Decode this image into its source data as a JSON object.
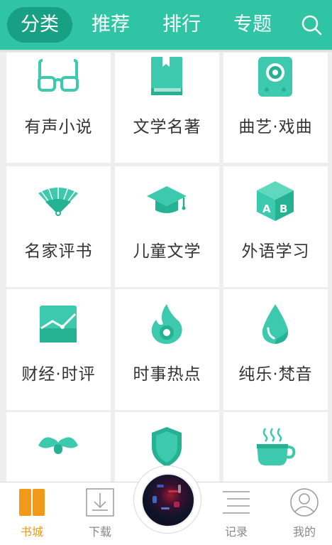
{
  "header": {
    "tabs": [
      {
        "label": "分类",
        "active": true
      },
      {
        "label": "推荐",
        "active": false
      },
      {
        "label": "排行",
        "active": false
      },
      {
        "label": "专题",
        "active": false
      }
    ],
    "search_icon": "search-icon"
  },
  "colors": {
    "brand": "#2fc4a4",
    "brand_dark": "#17a083",
    "icon": "#3cc9ae",
    "icon_dark": "#25b293",
    "active_nav": "#f19a1a"
  },
  "categories": [
    {
      "label": "有声小说",
      "icon": "glasses-icon"
    },
    {
      "label": "文学名著",
      "icon": "book-icon"
    },
    {
      "label": "曲艺·戏曲",
      "icon": "speaker-icon"
    },
    {
      "label": "名家评书",
      "icon": "fan-icon"
    },
    {
      "label": "儿童文学",
      "icon": "graduation-cap-icon"
    },
    {
      "label": "外语学习",
      "icon": "letter-cube-icon"
    },
    {
      "label": "财经·时评",
      "icon": "chart-icon"
    },
    {
      "label": "时事热点",
      "icon": "flame-icon"
    },
    {
      "label": "纯乐·梵音",
      "icon": "water-drop-icon"
    },
    {
      "label": "",
      "icon": "mustache-icon"
    },
    {
      "label": "",
      "icon": "shield-icon"
    },
    {
      "label": "",
      "icon": "coffee-cup-icon"
    }
  ],
  "bottom_nav": [
    {
      "label": "书城",
      "icon": "bookstore-icon",
      "active": true
    },
    {
      "label": "下载",
      "icon": "download-icon",
      "active": false
    },
    {
      "label": "记录",
      "icon": "history-list-icon",
      "active": false
    },
    {
      "label": "我的",
      "icon": "profile-icon",
      "active": false
    }
  ],
  "player": {
    "icon": "now-playing-disc"
  }
}
